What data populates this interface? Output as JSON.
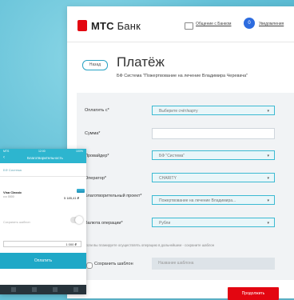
{
  "header": {
    "logo_main": "МТС",
    "logo_sub": "Банк",
    "chat_link": "Общение с Банком",
    "notifications_link": "Уведомления",
    "notifications_count": "0"
  },
  "page": {
    "back_label": "Назад",
    "title": "Платёж",
    "subtitle": "БФ Система \"Пожертвование на лечение Владимира Черевача\""
  },
  "form": {
    "pay_from_label": "Оплатить с*",
    "pay_from_value": "Выберите счёт/карту",
    "amount_label": "Сумма*",
    "provider_label": "Провайдер*",
    "provider_value": "БФ \"Система\"",
    "operator_label": "Оператор*",
    "operator_value": "CHARITY",
    "project_label": "Благотворительный проект*",
    "project_value": "Пожертвование на лечение Владимира...",
    "currency_label": "Валюта операции*",
    "currency_value": "Рубли",
    "hint": "Если вы планируете осуществлять операцию в дальнейшем - сохраните шаблон",
    "save_template_label": "Сохранить шаблон",
    "template_placeholder": "Название шаблона",
    "continue_label": "Продолжить"
  },
  "phone": {
    "status_left": "MTS",
    "status_time": "12:00",
    "status_right": "100%",
    "nav_back": "‹",
    "nav_title": "Благотворительность",
    "subtitle": "БФ Система",
    "card_name": "Visa Classic",
    "card_number": "•••• 0000",
    "card_amount": "5 185,41 ₽",
    "toggle_label": "Сохранить шаблон",
    "amount": "1 000  ₽",
    "pay_label": "Оплатить"
  },
  "colors": {
    "accent": "#e30611",
    "teal": "#3cbad2",
    "background": "#63c0d7"
  }
}
